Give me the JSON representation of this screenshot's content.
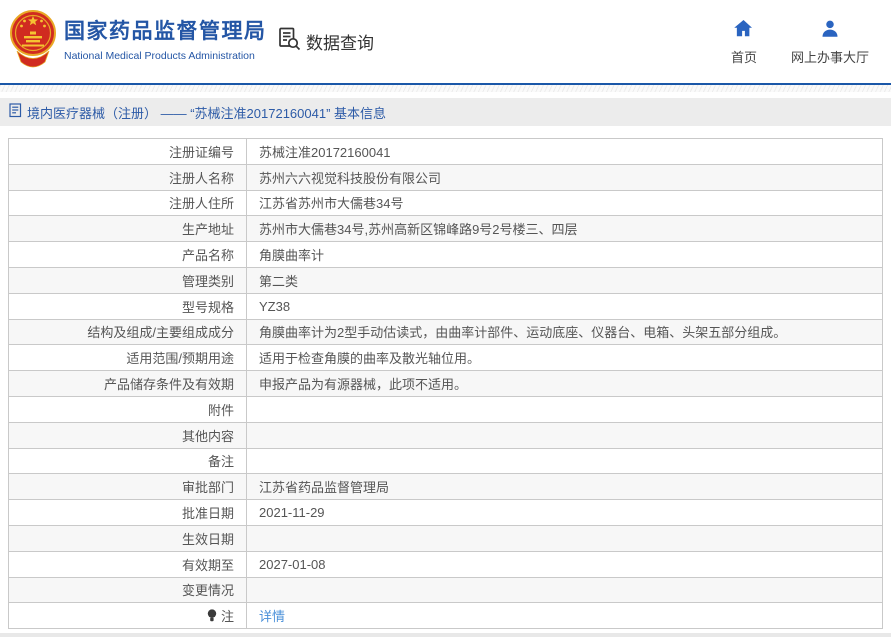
{
  "header": {
    "title": "国家药品监督管理局",
    "subtitle": "National Medical Products Administration",
    "data_query_label": "数据查询",
    "nav": [
      {
        "label": "首页",
        "icon": "home-icon"
      },
      {
        "label": "网上办事大厅",
        "icon": "user-icon"
      }
    ]
  },
  "breadcrumb": {
    "text": "境内医疗器械（注册） —— “苏械注准20172160041” 基本信息"
  },
  "table": {
    "rows": [
      {
        "label": "注册证编号",
        "value": "苏械注准20172160041"
      },
      {
        "label": "注册人名称",
        "value": "苏州六六视觉科技股份有限公司"
      },
      {
        "label": "注册人住所",
        "value": "江苏省苏州市大儒巷34号"
      },
      {
        "label": "生产地址",
        "value": "苏州市大儒巷34号,苏州高新区锦峰路9号2号楼三、四层"
      },
      {
        "label": "产品名称",
        "value": "角膜曲率计"
      },
      {
        "label": "管理类别",
        "value": "第二类"
      },
      {
        "label": "型号规格",
        "value": "YZ38"
      },
      {
        "label": "结构及组成/主要组成成分",
        "value": "角膜曲率计为2型手动估读式，由曲率计部件、运动底座、仪器台、电箱、头架五部分组成。"
      },
      {
        "label": "适用范围/预期用途",
        "value": "适用于检查角膜的曲率及散光轴位用。"
      },
      {
        "label": "产品储存条件及有效期",
        "value": "申报产品为有源器械，此项不适用。"
      },
      {
        "label": "附件",
        "value": ""
      },
      {
        "label": "其他内容",
        "value": ""
      },
      {
        "label": "备注",
        "value": ""
      },
      {
        "label": "审批部门",
        "value": "江苏省药品监督管理局"
      },
      {
        "label": "批准日期",
        "value": "2021-11-29"
      },
      {
        "label": "生效日期",
        "value": ""
      },
      {
        "label": "有效期至",
        "value": "2027-01-08"
      },
      {
        "label": "变更情况",
        "value": ""
      },
      {
        "label": "注",
        "label_icon": "bulb-icon",
        "value": "详情",
        "value_is_link": true
      }
    ]
  },
  "colors": {
    "brand_blue": "#2456a5",
    "header_line_blue": "#1a57a8",
    "breadcrumb_blue": "#2d5ba7",
    "link_blue": "#4a90d9",
    "emblem_red": "#d02b20",
    "emblem_gold": "#e9a826",
    "breadcrumb_bg": "#ececec",
    "alt_row_bg": "#f7f7f7",
    "table_border": "#c9c9c9"
  }
}
